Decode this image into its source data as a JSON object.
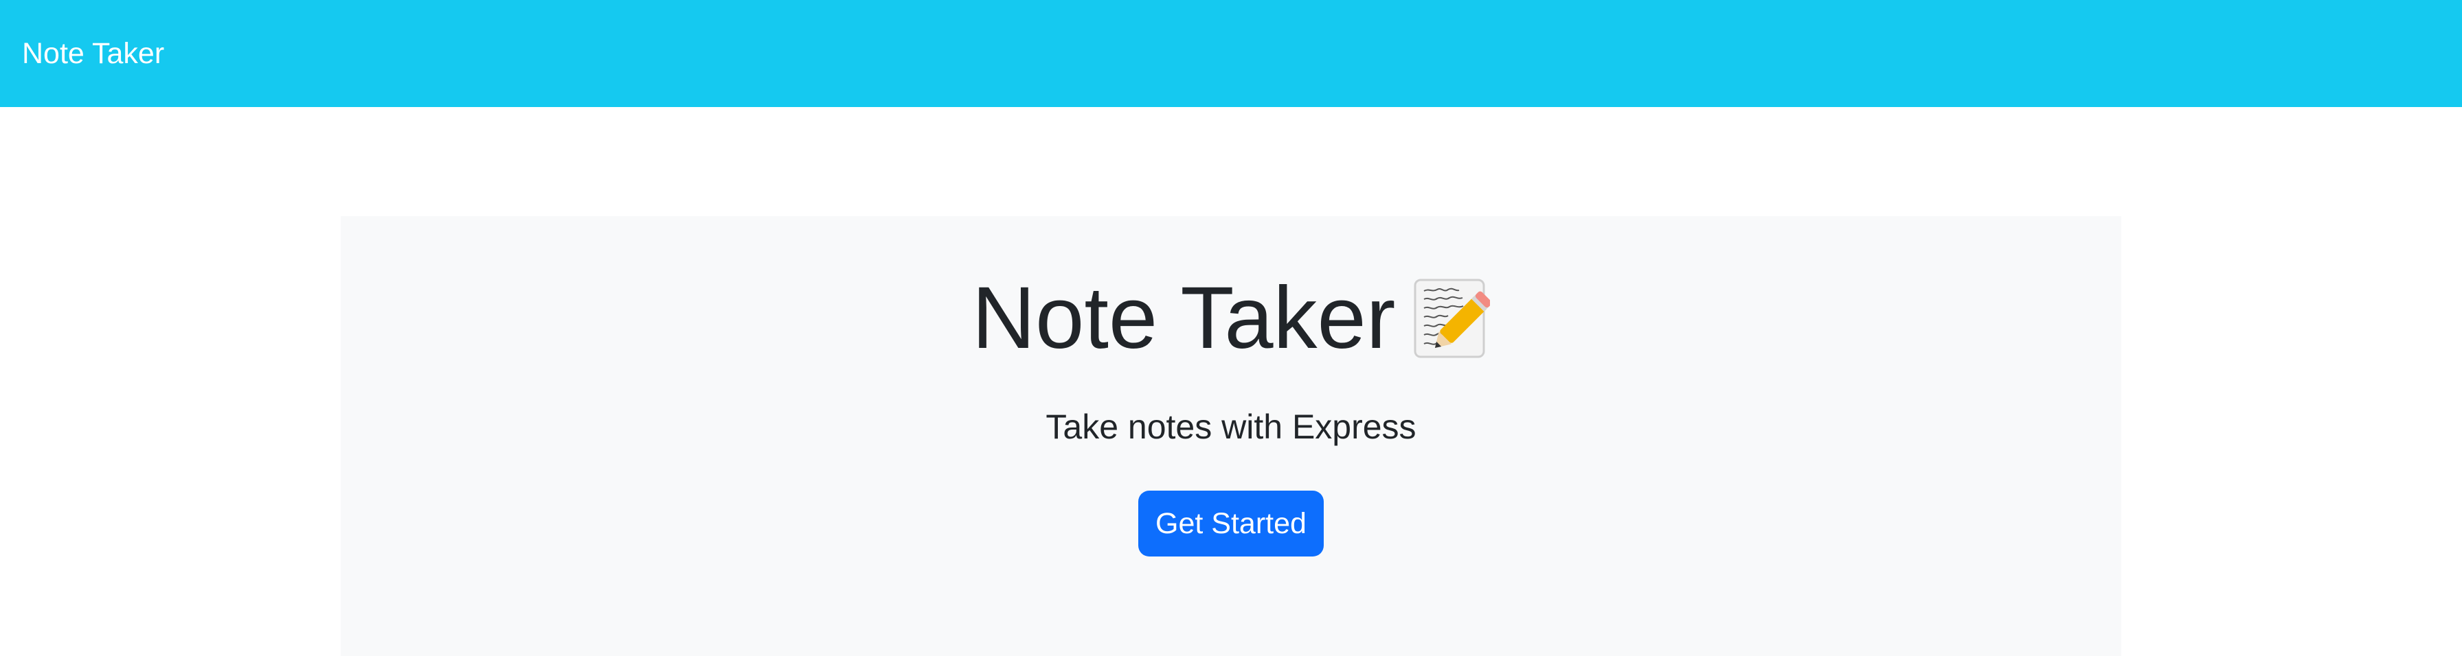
{
  "navbar": {
    "brand": "Note Taker",
    "color": "#15c9f0"
  },
  "hero": {
    "title": "Note Taker",
    "icon": "memo-icon",
    "subtitle": "Take notes with Express",
    "button_label": "Get Started",
    "button_color": "#0d6efd",
    "panel_color": "#f8f9fa"
  }
}
